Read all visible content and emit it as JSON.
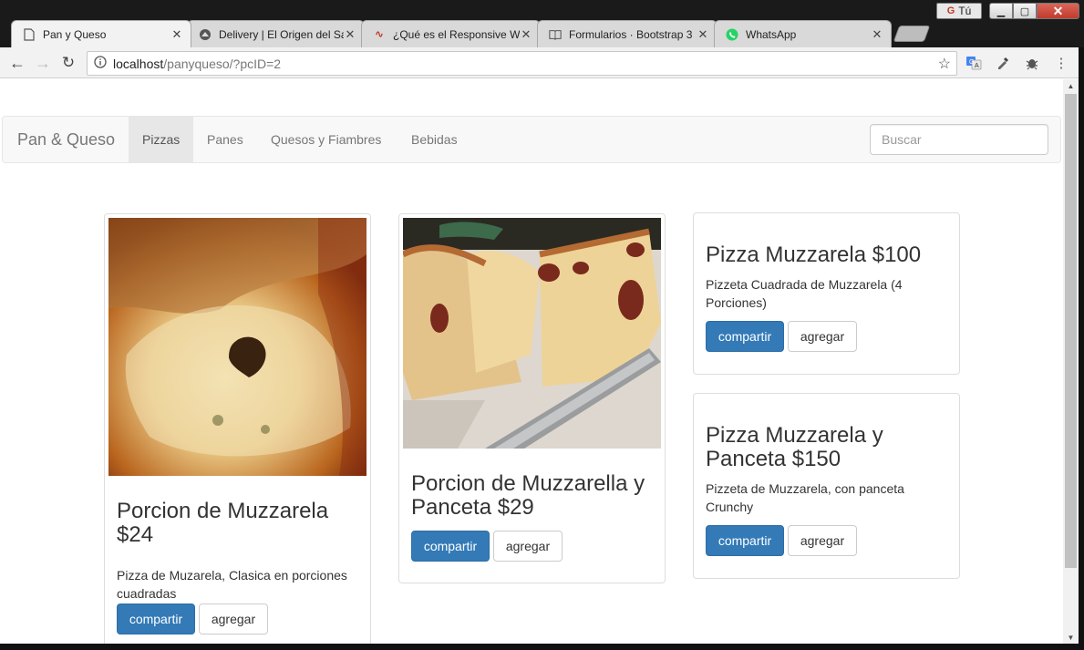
{
  "window": {
    "user_label": "Tú",
    "min_icon": "minimize-icon",
    "max_icon": "maximize-icon",
    "close_icon": "close-icon"
  },
  "tabs": [
    {
      "title": "Pan y Queso",
      "icon": "page-icon",
      "active": true
    },
    {
      "title": "Delivery | El Origen del Sabor",
      "icon": "site-icon",
      "active": false
    },
    {
      "title": "¿Qué es el Responsive Web Design?",
      "icon": "ow-icon",
      "active": false
    },
    {
      "title": "Formularios · Bootstrap 3",
      "icon": "book-icon",
      "active": false
    },
    {
      "title": "WhatsApp",
      "icon": "whatsapp-icon",
      "active": false
    }
  ],
  "address": {
    "host": "localhost",
    "path": "/panyqueso/?pcID=2"
  },
  "navbar": {
    "brand": "Pan & Queso",
    "items": [
      {
        "label": "Pizzas",
        "active": true
      },
      {
        "label": "Panes",
        "active": false
      },
      {
        "label": "Quesos y Fiambres",
        "active": false
      },
      {
        "label": "Bebidas",
        "active": false
      }
    ],
    "search_placeholder": "Buscar"
  },
  "products": [
    {
      "title": "Porcion de Muzzarela $24",
      "description": "Pizza de Muzarela, Clasica en porciones cuadradas",
      "has_image": true
    },
    {
      "title": "Porcion de Muzzarella y Panceta $29",
      "description": "",
      "has_image": true
    },
    {
      "title": "Pizza Muzzarela $100",
      "description": "Pizzeta Cuadrada de Muzzarela (4 Porciones)",
      "has_image": false
    },
    {
      "title": "Pizza Muzzarela y Panceta $150",
      "description": "Pizzeta de Muzzarela, con panceta Crunchy",
      "has_image": false
    }
  ],
  "buttons": {
    "share": "compartir",
    "add": "agregar"
  },
  "colors": {
    "primary": "#337ab7",
    "navbar_bg": "#f8f8f8",
    "active_nav": "#e7e7e7"
  }
}
